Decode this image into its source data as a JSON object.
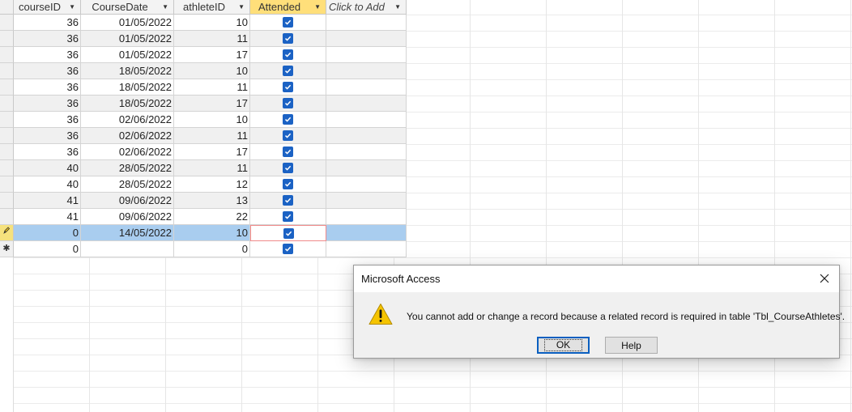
{
  "columns": [
    {
      "label": "courseID"
    },
    {
      "label": "CourseDate"
    },
    {
      "label": "athleteID"
    },
    {
      "label": "Attended"
    },
    {
      "label": "Click to Add"
    }
  ],
  "rows": [
    {
      "courseID": "36",
      "date": "01/05/2022",
      "athleteID": "10",
      "attended": true
    },
    {
      "courseID": "36",
      "date": "01/05/2022",
      "athleteID": "11",
      "attended": true
    },
    {
      "courseID": "36",
      "date": "01/05/2022",
      "athleteID": "17",
      "attended": true
    },
    {
      "courseID": "36",
      "date": "18/05/2022",
      "athleteID": "10",
      "attended": true
    },
    {
      "courseID": "36",
      "date": "18/05/2022",
      "athleteID": "11",
      "attended": true
    },
    {
      "courseID": "36",
      "date": "18/05/2022",
      "athleteID": "17",
      "attended": true
    },
    {
      "courseID": "36",
      "date": "02/06/2022",
      "athleteID": "10",
      "attended": true
    },
    {
      "courseID": "36",
      "date": "02/06/2022",
      "athleteID": "11",
      "attended": true
    },
    {
      "courseID": "36",
      "date": "02/06/2022",
      "athleteID": "17",
      "attended": true
    },
    {
      "courseID": "40",
      "date": "28/05/2022",
      "athleteID": "11",
      "attended": true
    },
    {
      "courseID": "40",
      "date": "28/05/2022",
      "athleteID": "12",
      "attended": true
    },
    {
      "courseID": "41",
      "date": "09/06/2022",
      "athleteID": "13",
      "attended": true
    },
    {
      "courseID": "41",
      "date": "09/06/2022",
      "athleteID": "22",
      "attended": true
    }
  ],
  "editing_row": {
    "courseID": "0",
    "date": "14/05/2022",
    "athleteID": "10",
    "attended": true,
    "selector_icon": "pencil-icon"
  },
  "new_row": {
    "courseID": "0",
    "date": "",
    "athleteID": "0",
    "attended": true,
    "selector_glyph": "✱"
  },
  "dialog": {
    "title": "Microsoft Access",
    "message": "You cannot add or change a record because a related record is required in table 'Tbl_CourseAthletes'.",
    "ok_label": "OK",
    "help_label": "Help",
    "icon": "warning-icon"
  },
  "colors": {
    "active_header": "#ffdf7a",
    "current_row": "#a9cdef",
    "checkbox": "#1b62c4",
    "warning": "#f5c400"
  }
}
